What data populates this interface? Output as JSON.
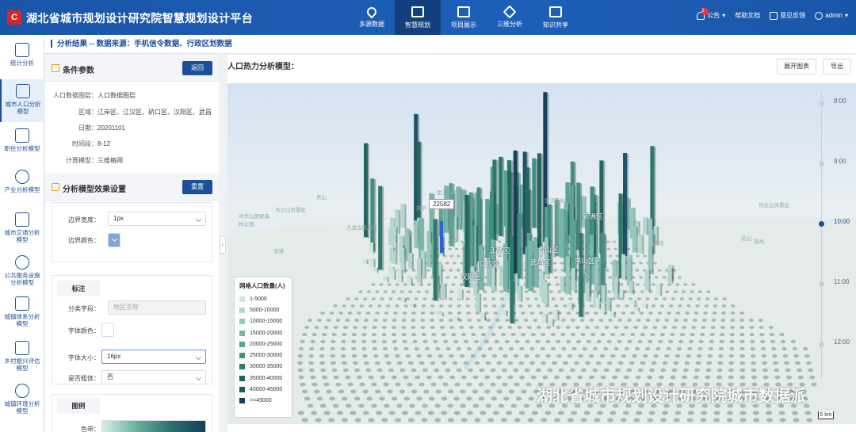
{
  "header": {
    "logo_char": "C",
    "title": "湖北省城市规划设计研究院智慧规划设计平台",
    "nav": [
      {
        "label": "多源数据",
        "icon": "map-pin-icon"
      },
      {
        "label": "智慧规划",
        "icon": "chart-board-icon"
      },
      {
        "label": "项目展示",
        "icon": "project-icon"
      },
      {
        "label": "三维分析",
        "icon": "cube-icon"
      },
      {
        "label": "知识共享",
        "icon": "book-icon"
      }
    ],
    "active_nav": "智慧规划",
    "notice_label": "公告",
    "notice_count": "2",
    "help_label": "帮助文档",
    "feedback_label": "意见反馈",
    "user_label": "admin"
  },
  "sidebar": {
    "items": [
      {
        "label": "统计分析",
        "icon": "statistics-icon"
      },
      {
        "label": "城市人口分析模型",
        "icon": "population-icon"
      },
      {
        "label": "职住分析模型",
        "icon": "jobs-housing-icon"
      },
      {
        "label": "产业分析模型",
        "icon": "industry-icon"
      },
      {
        "label": "城市交通分析模型",
        "icon": "bus-icon"
      },
      {
        "label": "公共服务设施分析模型",
        "icon": "globe-icon"
      },
      {
        "label": "城镇体系分析模型",
        "icon": "building-icon"
      },
      {
        "label": "乡村振兴评估模型",
        "icon": "house-icon"
      },
      {
        "label": "城镇环境分析模型",
        "icon": "environment-icon"
      }
    ]
  },
  "breadcrumb": {
    "text": "分析结果 -- 数据来源：手机信令数据、行政区划数据"
  },
  "conditions": {
    "title": "条件参数",
    "back_button": "返回",
    "rows": [
      {
        "key": "人口数据图层：",
        "value": "人口数据图层"
      },
      {
        "key": "区域：",
        "value": "江岸区、江汉区、硚口区、汉阳区、武昌"
      },
      {
        "key": "日期：",
        "value": "20201101"
      },
      {
        "key": "时间段：",
        "value": "8-12"
      },
      {
        "key": "计算模型：",
        "value": "三维格网"
      }
    ]
  },
  "settings": {
    "title": "分析模型效果设置",
    "reset_button": "重置",
    "border_width_label": "边界宽度：",
    "border_width_value": "1px",
    "border_color_label": "边界颜色：",
    "label_section": "标注",
    "class_field_label": "分类字段：",
    "class_field_placeholder": "地区名称",
    "font_color_label": "字体颜色：",
    "font_size_label": "字体大小：",
    "font_size_value": "16px",
    "bold_label": "是否粗体：",
    "bold_value": "否",
    "legend_section": "图例",
    "colorband_label": "色带："
  },
  "main": {
    "title": "人口热力分析模型：",
    "expand_button": "展开图表",
    "export_button": "导出"
  },
  "map": {
    "tooltip_value": "22582",
    "districts": [
      "江岸区",
      "青山区",
      "江汉区",
      "武昌区",
      "洪山区",
      "汉阳区",
      "新洲区"
    ],
    "place_labels": [
      "灵山",
      "中华山国家森林公园",
      "马公山风景区",
      "金三山国",
      "天子",
      "九龙山风景区",
      "孝感",
      "葛店",
      "鄂州",
      "花山",
      "司仗山风景区",
      "孝感",
      "武汉东站"
    ],
    "watermark": "湖北省城市规划设计研究院城市数据派",
    "scale_label": "5 km"
  },
  "legend": {
    "title": "网格人口数量(人)",
    "items": [
      {
        "label": "1-5000",
        "color": "#cde6e1"
      },
      {
        "label": "5000-10000",
        "color": "#b3d8d0"
      },
      {
        "label": "10000-15000",
        "color": "#95c8bd"
      },
      {
        "label": "15000-20000",
        "color": "#77b6a9"
      },
      {
        "label": "20000-25000",
        "color": "#5aa392"
      },
      {
        "label": "25000-30000",
        "color": "#418f7e"
      },
      {
        "label": "30000-35000",
        "color": "#2d7a6b"
      },
      {
        "label": "35000-40000",
        "color": "#236660"
      },
      {
        "label": "40000-45000",
        "color": "#1e5467"
      },
      {
        "label": ">=45000",
        "color": "#173f5a"
      }
    ]
  },
  "timeline": {
    "ticks": [
      "8:00",
      "9:00",
      "10:00",
      "11:00",
      "12:00"
    ],
    "current": "10:00"
  }
}
